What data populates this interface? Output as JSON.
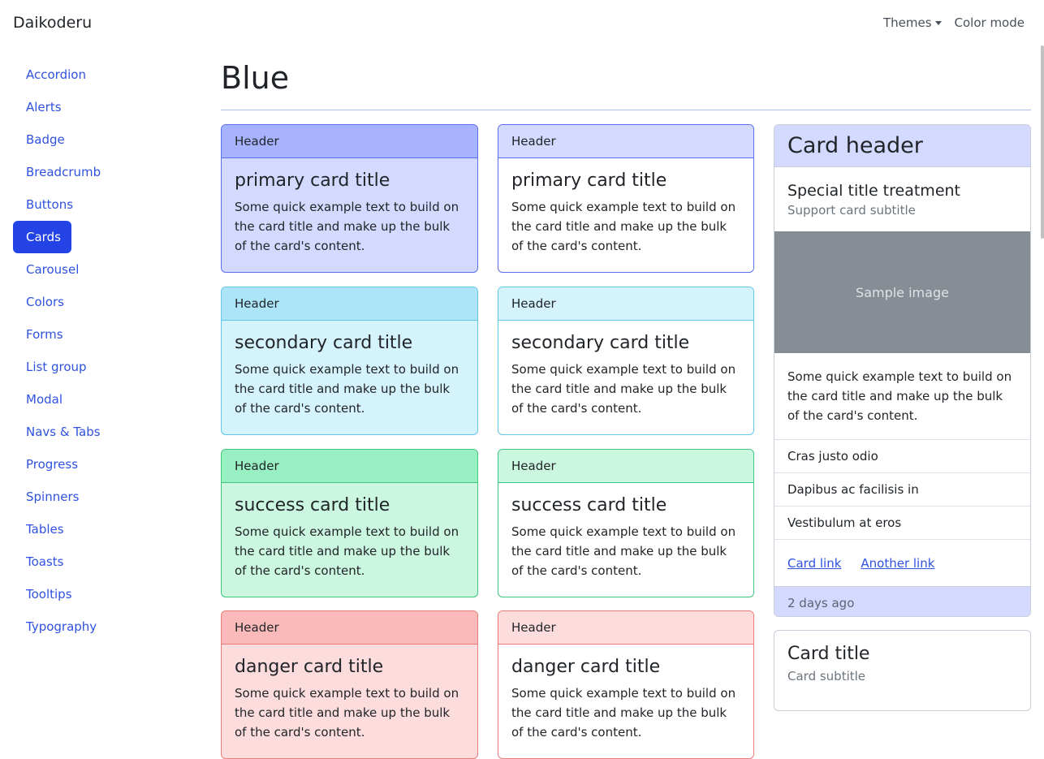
{
  "navbar": {
    "brand": "Daikoderu",
    "themes_label": "Themes",
    "color_mode_label": "Color mode"
  },
  "sidebar": {
    "items": [
      {
        "label": "Accordion"
      },
      {
        "label": "Alerts"
      },
      {
        "label": "Badge"
      },
      {
        "label": "Breadcrumb"
      },
      {
        "label": "Buttons"
      },
      {
        "label": "Cards",
        "active": true
      },
      {
        "label": "Carousel"
      },
      {
        "label": "Colors"
      },
      {
        "label": "Forms"
      },
      {
        "label": "List group"
      },
      {
        "label": "Modal"
      },
      {
        "label": "Navs & Tabs"
      },
      {
        "label": "Progress"
      },
      {
        "label": "Spinners"
      },
      {
        "label": "Tables"
      },
      {
        "label": "Toasts"
      },
      {
        "label": "Tooltips"
      },
      {
        "label": "Typography"
      }
    ]
  },
  "main": {
    "title": "Blue",
    "card_text": "Some quick example text to build on the card title and make up the bulk of the card's content.",
    "header_label": "Header",
    "cards": [
      {
        "title": "primary card title",
        "filled_bg": "#d3d9ff",
        "filled_header": "#a8b3ff",
        "filled_border": "#5b6ef0",
        "outline_header": "#d3d9ff",
        "outline_border": "#5b6ef0",
        "text_color": "#1d2fa8"
      },
      {
        "title": "secondary card title",
        "filled_bg": "#d4f3fc",
        "filled_header": "#ade5f8",
        "filled_border": "#63c6ea",
        "outline_header": "#d4f3fc",
        "outline_border": "#63c6ea",
        "text_color": "#1a6b85"
      },
      {
        "title": "success card title",
        "filled_bg": "#cbf6df",
        "filled_header": "#98efc1",
        "filled_border": "#3fc67d",
        "outline_header": "#cbf6df",
        "outline_border": "#3fc67d",
        "text_color": "#1d7c48"
      },
      {
        "title": "danger card title",
        "filled_bg": "#fcdcdc",
        "filled_header": "#fbbaba",
        "filled_border": "#eb7b7b",
        "outline_header": "#fcdcdc",
        "outline_border": "#eb7b7b",
        "text_color": "#9c2b2b"
      }
    ]
  },
  "side_card": {
    "header": "Card header",
    "special_title": "Special title treatment",
    "special_subtitle": "Support card subtitle",
    "image_label": "Sample image",
    "body_text": "Some quick example text to build on the card title and make up the bulk of the card's content.",
    "list": [
      "Cras justo odio",
      "Dapibus ac facilisis in",
      "Vestibulum at eros"
    ],
    "link1": "Card link",
    "link2": "Another link",
    "footer": "2 days ago"
  },
  "second_card": {
    "title": "Card title",
    "subtitle": "Card subtitle"
  }
}
